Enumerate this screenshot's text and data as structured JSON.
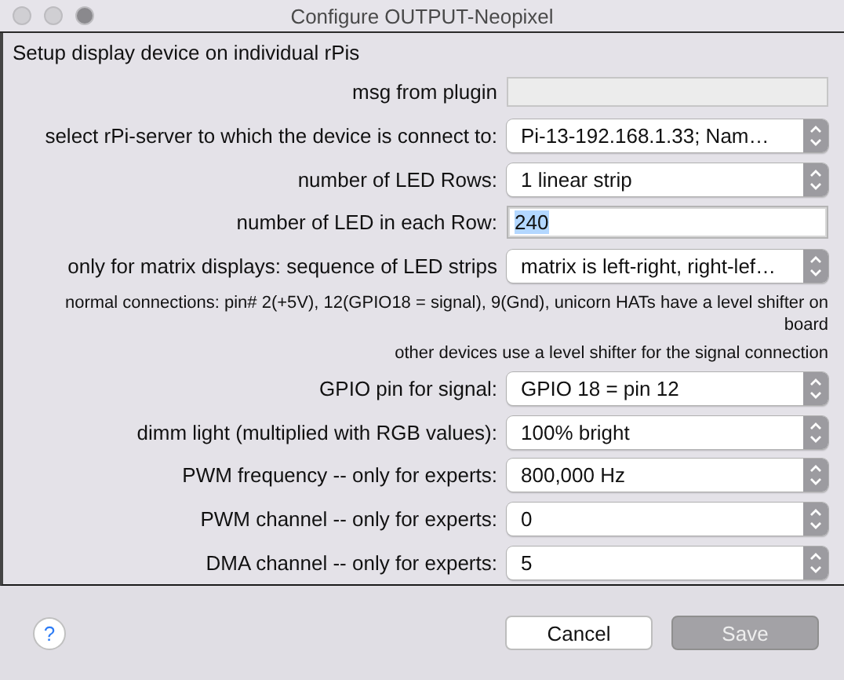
{
  "window": {
    "title": "Configure OUTPUT-Neopixel"
  },
  "heading": "Setup display device on individual rPis",
  "rows": [
    {
      "kind": "readonly",
      "label": "msg from plugin",
      "value": ""
    },
    {
      "kind": "select",
      "label": "select rPi-server to which the device is connect to:",
      "value": "Pi-13-192.168.1.33;  Nam…"
    },
    {
      "kind": "select",
      "label": "number of LED Rows:",
      "value": "1 linear strip"
    },
    {
      "kind": "text",
      "label": "number of LED in each Row:",
      "value": "240",
      "highlighted": true
    },
    {
      "kind": "select",
      "label": "only for matrix displays: sequence of LED strips",
      "value": "matrix is left-right, right-lef…"
    },
    {
      "kind": "note",
      "label": "normal connections: pin# 2(+5V), 12(GPIO18 = signal), 9(Gnd), unicorn HATs have a level shifter on board"
    },
    {
      "kind": "note",
      "label": "other devices use a level shifter for the signal connection"
    },
    {
      "kind": "select",
      "label": "GPIO pin for signal:",
      "value": "GPIO 18 = pin 12"
    },
    {
      "kind": "select",
      "label": "dimm light (multiplied with RGB values):",
      "value": "100% bright"
    },
    {
      "kind": "select",
      "label": "PWM frequency -- only for experts:",
      "value": "800,000 Hz"
    },
    {
      "kind": "select",
      "label": "PWM channel -- only for experts:",
      "value": "0"
    },
    {
      "kind": "select",
      "label": "DMA channel -- only for experts:",
      "value": "5"
    }
  ],
  "help": "?",
  "buttons": [
    {
      "label": "Cancel",
      "disabled": false
    },
    {
      "label": "Save",
      "disabled": true
    }
  ]
}
